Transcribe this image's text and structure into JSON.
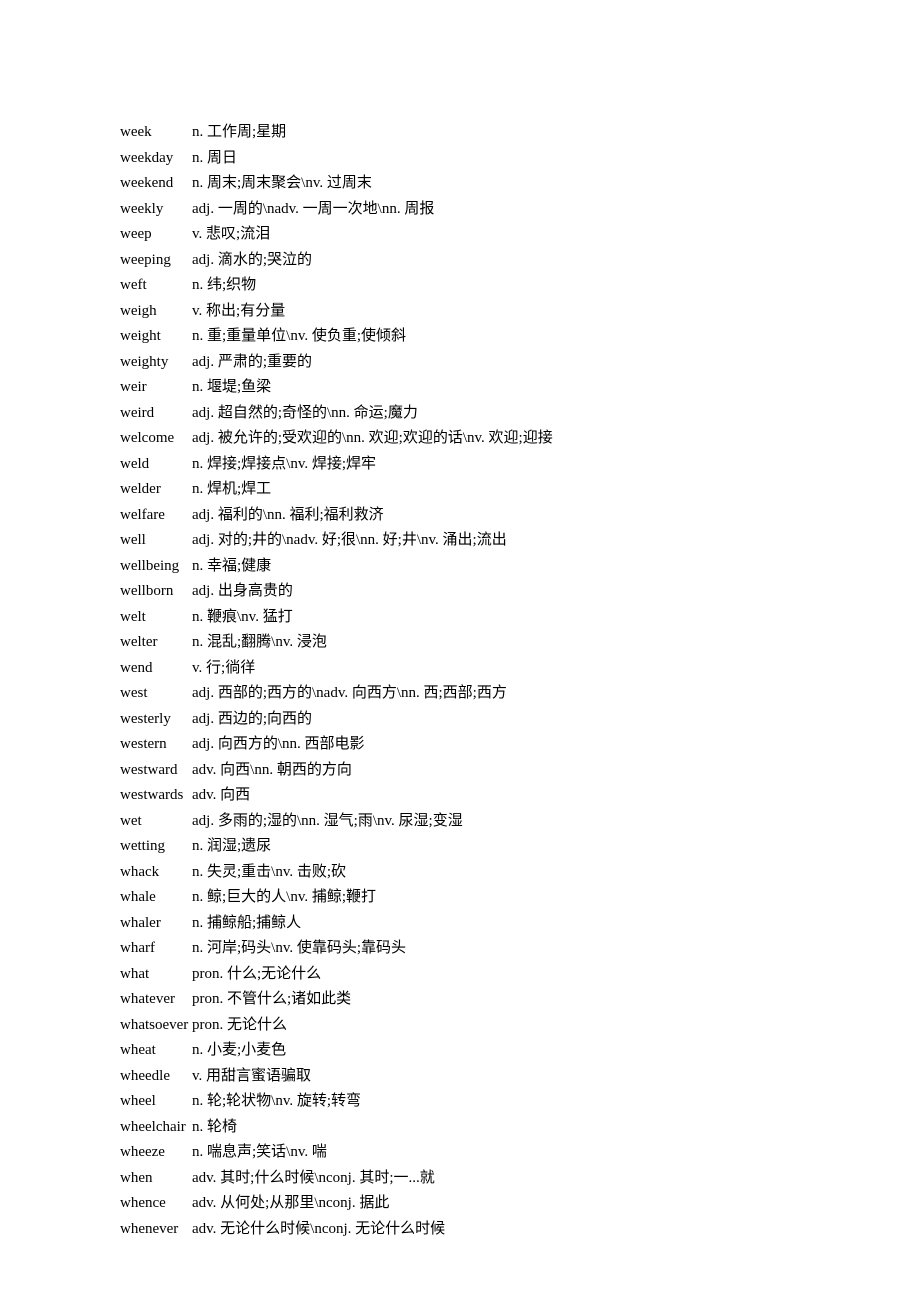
{
  "entries": [
    {
      "word": "week",
      "def": "n. 工作周;星期"
    },
    {
      "word": "weekday",
      "def": "n. 周日"
    },
    {
      "word": "weekend",
      "def": "n. 周末;周末聚会\\nv. 过周末"
    },
    {
      "word": "weekly",
      "def": "adj. 一周的\\nadv. 一周一次地\\nn. 周报"
    },
    {
      "word": "weep",
      "def": "v. 悲叹;流泪"
    },
    {
      "word": "weeping",
      "def": "adj. 滴水的;哭泣的"
    },
    {
      "word": "weft",
      "def": "n. 纬;织物"
    },
    {
      "word": "weigh",
      "def": "v. 称出;有分量"
    },
    {
      "word": "weight",
      "def": "n. 重;重量单位\\nv. 使负重;使倾斜"
    },
    {
      "word": "weighty",
      "def": "adj. 严肃的;重要的"
    },
    {
      "word": "weir",
      "def": "n. 堰堤;鱼梁"
    },
    {
      "word": "weird",
      "def": "adj. 超自然的;奇怪的\\nn. 命运;魔力"
    },
    {
      "word": "welcome",
      "def": "adj. 被允许的;受欢迎的\\nn. 欢迎;欢迎的话\\nv. 欢迎;迎接"
    },
    {
      "word": "weld",
      "def": "n. 焊接;焊接点\\nv. 焊接;焊牢"
    },
    {
      "word": "welder",
      "def": "n. 焊机;焊工"
    },
    {
      "word": "welfare",
      "def": "adj. 福利的\\nn. 福利;福利救济"
    },
    {
      "word": "well",
      "def": "adj. 对的;井的\\nadv. 好;很\\nn. 好;井\\nv. 涌出;流出"
    },
    {
      "word": "wellbeing",
      "def": "n. 幸福;健康"
    },
    {
      "word": "wellborn",
      "def": "adj. 出身高贵的"
    },
    {
      "word": "welt",
      "def": "n. 鞭痕\\nv. 猛打"
    },
    {
      "word": "welter",
      "def": "n. 混乱;翻腾\\nv. 浸泡"
    },
    {
      "word": "wend",
      "def": "v. 行;徜徉"
    },
    {
      "word": "west",
      "def": "adj. 西部的;西方的\\nadv. 向西方\\nn. 西;西部;西方"
    },
    {
      "word": "westerly",
      "def": "adj. 西边的;向西的"
    },
    {
      "word": "western",
      "def": "adj. 向西方的\\nn. 西部电影"
    },
    {
      "word": "westward",
      "def": "adv. 向西\\nn. 朝西的方向"
    },
    {
      "word": "westwards",
      "def": "adv. 向西"
    },
    {
      "word": "wet",
      "def": "adj. 多雨的;湿的\\nn. 湿气;雨\\nv. 尿湿;变湿"
    },
    {
      "word": "wetting",
      "def": "n. 润湿;遗尿"
    },
    {
      "word": "whack",
      "def": "n. 失灵;重击\\nv. 击败;砍"
    },
    {
      "word": "whale",
      "def": "n. 鲸;巨大的人\\nv. 捕鲸;鞭打"
    },
    {
      "word": "whaler",
      "def": "n. 捕鲸船;捕鲸人"
    },
    {
      "word": "wharf",
      "def": "n. 河岸;码头\\nv. 使靠码头;靠码头"
    },
    {
      "word": "what",
      "def": "pron. 什么;无论什么"
    },
    {
      "word": "whatever",
      "def": "pron. 不管什么;诸如此类"
    },
    {
      "word": "whatsoever",
      "def": "pron. 无论什么"
    },
    {
      "word": "wheat",
      "def": "n. 小麦;小麦色"
    },
    {
      "word": "wheedle",
      "def": "v. 用甜言蜜语骗取"
    },
    {
      "word": "wheel",
      "def": "n. 轮;轮状物\\nv. 旋转;转弯"
    },
    {
      "word": "wheelchair",
      "def": "n. 轮椅"
    },
    {
      "word": "wheeze",
      "def": "n. 喘息声;笑话\\nv. 喘"
    },
    {
      "word": "when",
      "def": "adv. 其时;什么时候\\nconj. 其时;一...就"
    },
    {
      "word": "whence",
      "def": "adv. 从何处;从那里\\nconj. 据此"
    },
    {
      "word": "whenever",
      "def": "adv. 无论什么时候\\nconj. 无论什么时候"
    }
  ]
}
